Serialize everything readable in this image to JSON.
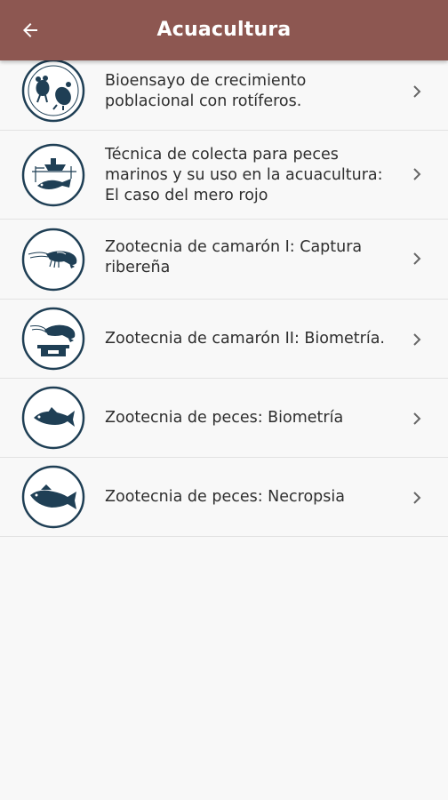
{
  "appbar": {
    "title": "Acuacultura",
    "back_icon": "arrow-left-icon",
    "color": "#8d5751"
  },
  "list": {
    "items": [
      {
        "label": "Bioensayo de crecimiento\npoblacional con rotíferos.",
        "icon": "rotifer-icon"
      },
      {
        "label": "Técnica de colecta para peces\nmarinos y su uso en la acuacultura:\nEl caso del mero rojo",
        "icon": "fishing-boat-icon"
      },
      {
        "label": "Zootecnia de camarón I: Captura\nribereña",
        "icon": "shrimp-icon"
      },
      {
        "label": "Zootecnia de camarón II: Biometría.",
        "icon": "shrimp-scale-icon"
      },
      {
        "label": "Zootecnia de peces: Biometría",
        "icon": "fish-icon"
      },
      {
        "label": "Zootecnia de peces: Necropsia",
        "icon": "fish-necropsy-icon"
      }
    ]
  },
  "colors": {
    "icon": "#1f3f55",
    "text": "#2e2e2e",
    "divider": "#e2e2e2",
    "background": "#f8f8f8"
  }
}
